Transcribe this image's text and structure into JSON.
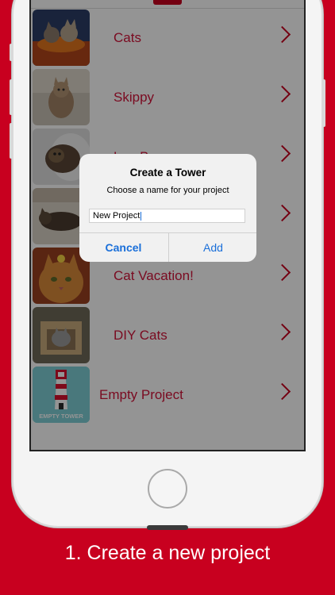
{
  "list": {
    "items": [
      {
        "label": "Cats"
      },
      {
        "label": "Skippy"
      },
      {
        "label": "Lee Bus"
      },
      {
        "label": ""
      },
      {
        "label": "Cat Vacation!"
      },
      {
        "label": "DIY Cats"
      },
      {
        "label": "Empty Project"
      }
    ],
    "empty_thumb_text": "EMPTY TOWER"
  },
  "dialog": {
    "title": "Create a Tower",
    "message": "Choose a name for your project",
    "input_value": "New Project",
    "cancel_label": "Cancel",
    "add_label": "Add"
  },
  "caption": "1. Create a new project",
  "colors": {
    "brand_red": "#c8001f",
    "label_red": "#d3143a",
    "ios_blue": "#1a6fd9"
  },
  "icons": [
    "chevron-right-icon",
    "lighthouse-icon",
    "home-button"
  ]
}
